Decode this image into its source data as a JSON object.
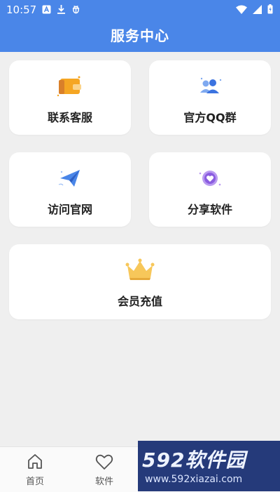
{
  "status_bar": {
    "time": "10:57"
  },
  "header": {
    "title": "服务中心"
  },
  "cards": [
    {
      "label": "联系客服",
      "icon": "wallet-icon"
    },
    {
      "label": "官方QQ群",
      "icon": "group-icon"
    },
    {
      "label": "访问官网",
      "icon": "paper-plane-icon"
    },
    {
      "label": "分享软件",
      "icon": "heart-badge-icon"
    },
    {
      "label": "会员充值",
      "icon": "crown-icon"
    }
  ],
  "bottom_nav": {
    "items": [
      {
        "label": "首页",
        "icon": "home-icon"
      },
      {
        "label": "软件",
        "icon": "heart-icon"
      }
    ]
  },
  "watermark": {
    "main": "592软件园",
    "url": "www.592xiazai.com"
  },
  "colors": {
    "accent": "#4a86e8",
    "background": "#efefef",
    "watermark_bg": "#253a7a"
  }
}
